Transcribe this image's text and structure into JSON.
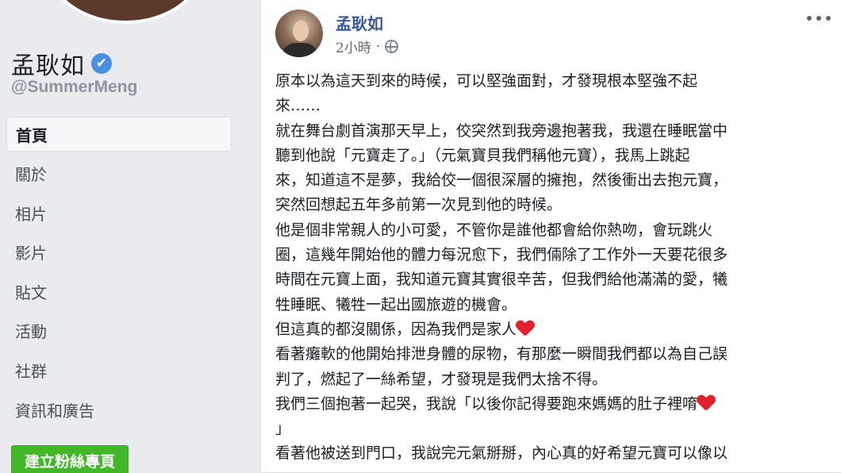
{
  "sidebar": {
    "page_name": "孟耿如",
    "verified_mark": "✔",
    "handle": "@SummerMeng",
    "nav_items": [
      {
        "label": "首頁",
        "active": true
      },
      {
        "label": "關於"
      },
      {
        "label": "相片"
      },
      {
        "label": "影片"
      },
      {
        "label": "貼文"
      },
      {
        "label": "活動"
      },
      {
        "label": "社群"
      },
      {
        "label": "資訊和廣告"
      }
    ],
    "create_page_button": "建立粉絲專頁"
  },
  "post": {
    "author": "孟耿如",
    "time": "2小時",
    "dot": "·",
    "privacy_icon": "globe-icon",
    "more_icon": "more-horizontal-icon",
    "lines": [
      "原本以為這天到來的時候，可以堅強面對，才發現根本堅強不起",
      "來……",
      "就在舞台劇首演那天早上，佼突然到我旁邊抱著我，我還在睡眠當中",
      "聽到他說「元寶走了。」（元氣寶貝我們稱他元寶），我馬上跳起",
      "來，知道這不是夢，我給佼一個很深層的擁抱，然後衝出去抱元寶，",
      "突然回想起五年多前第一次見到他的時候。",
      "他是個非常親人的小可愛，不管你是誰他都會給你熱吻，會玩跳火",
      "圈，這幾年開始他的體力每況愈下，我們倆除了工作外一天要花很多",
      "時間在元寶上面，我知道元寶其實很辛苦，但我們給他滿滿的愛，犧",
      "牲睡眠、犧牲一起出國旅遊的機會。",
      "但這真的都沒關係，因為我們是家人",
      "看著癱軟的他開始排泄身體的尿物，有那麼一瞬間我們都以為自己誤",
      "判了，燃起了一絲希望，才發現是我們太捨不得。",
      "我們三個抱著一起哭，我說「以後你記得要跑來媽媽的肚子裡唷",
      "」",
      "看著他被送到門口，我說完元氣掰掰，內心真的好希望元寶可以像以"
    ],
    "heart_emoji_lines": [
      10,
      13
    ]
  },
  "colors": {
    "background": "#e9ebee",
    "link_blue": "#385898",
    "verified_blue": "#4a90e2",
    "create_button_green": "#42b72a",
    "heart_red": "#e0212e"
  }
}
